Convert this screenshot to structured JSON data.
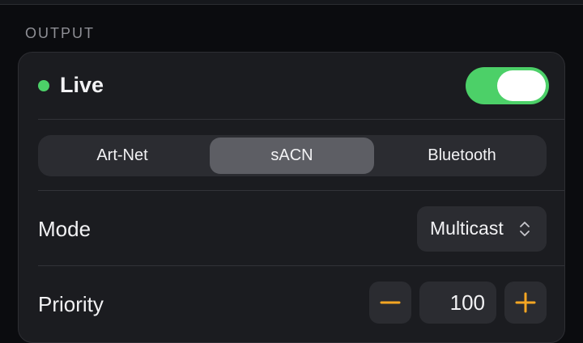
{
  "section": {
    "title": "OUTPUT"
  },
  "live": {
    "label": "Live",
    "status_color": "#4cd068",
    "toggle_on": true,
    "toggle_color": "#4cd068"
  },
  "protocol": {
    "options": [
      "Art-Net",
      "sACN",
      "Bluetooth"
    ],
    "selected": "sACN"
  },
  "mode": {
    "label": "Mode",
    "value": "Multicast",
    "icon": "chevron-up-down-icon"
  },
  "priority": {
    "label": "Priority",
    "value": "100",
    "decrement_icon": "minus-icon",
    "increment_icon": "plus-icon",
    "accent_color": "#f5a623"
  }
}
